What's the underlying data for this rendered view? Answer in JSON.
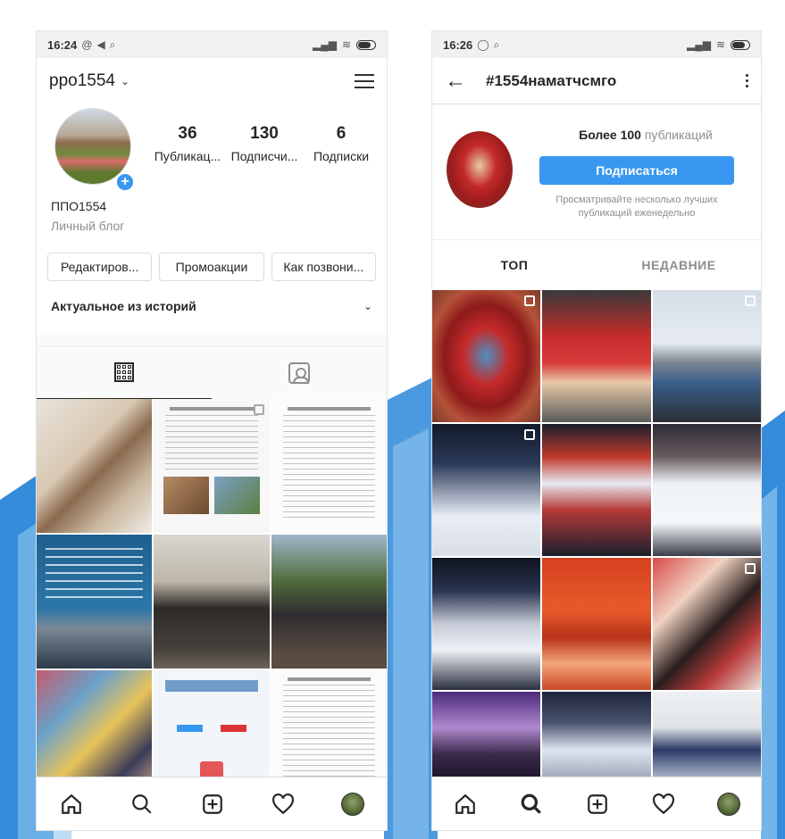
{
  "colors": {
    "accent": "#3897f0",
    "decor_blue": "#1e7fd6",
    "decor_light": "#8fc6ef"
  },
  "phone1": {
    "status": {
      "time": "16:24",
      "icons": [
        "settings-icon",
        "send-icon",
        "search-icon"
      ]
    },
    "username": "ppo1554",
    "stats": [
      {
        "num": "36",
        "label": "Публикац..."
      },
      {
        "num": "130",
        "label": "Подписчи..."
      },
      {
        "num": "6",
        "label": "Подписки"
      }
    ],
    "name": "ППО1554",
    "category": "Личный блог",
    "buttons": [
      "Редактиров...",
      "Промоакции",
      "Как позвони..."
    ],
    "highlights": "Актуальное из историй",
    "nav": [
      "home-icon",
      "search-icon",
      "add-icon",
      "heart-icon",
      "profile-avatar"
    ]
  },
  "phone2": {
    "status": {
      "time": "16:26",
      "icons": [
        "whatsapp-icon",
        "search-icon"
      ]
    },
    "hashtag": "#1554наматчсмго",
    "count_bold": "Более 100",
    "count_rest": " публикаций",
    "follow": "Подписаться",
    "description": "Просматривайте несколько лучших публикаций еженедельно",
    "tabs": [
      "ТОП",
      "НЕДАВНИЕ"
    ],
    "nav": [
      "home-icon",
      "search-icon",
      "add-icon",
      "heart-icon",
      "profile-avatar"
    ]
  }
}
